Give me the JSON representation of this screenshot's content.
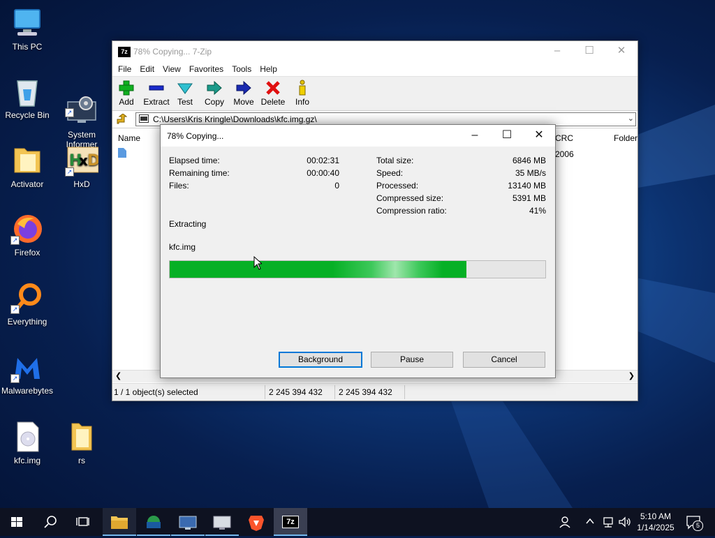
{
  "desktop": {
    "icons": [
      {
        "label": "This PC"
      },
      {
        "label": "Recycle Bin"
      },
      {
        "label": "System\nInformer"
      },
      {
        "label": "Activator"
      },
      {
        "label": "HxD"
      },
      {
        "label": "Firefox"
      },
      {
        "label": "Everything"
      },
      {
        "label": "Malwarebytes"
      },
      {
        "label": "kfc.img"
      },
      {
        "label": "rs"
      }
    ]
  },
  "main_window": {
    "title": "78% Copying... 7-Zip",
    "app_icon_text": "7z",
    "menu": [
      "File",
      "Edit",
      "View",
      "Favorites",
      "Tools",
      "Help"
    ],
    "toolbar": [
      {
        "label": "Add",
        "icon": "add-icon"
      },
      {
        "label": "Extract",
        "icon": "extract-icon"
      },
      {
        "label": "Test",
        "icon": "test-icon"
      },
      {
        "label": "Copy",
        "icon": "copy-icon"
      },
      {
        "label": "Move",
        "icon": "move-icon"
      },
      {
        "label": "Delete",
        "icon": "delete-icon"
      },
      {
        "label": "Info",
        "icon": "info-icon"
      }
    ],
    "path": "C:\\Users\\Kris Kringle\\Downloads\\kfc.img.gz\\",
    "columns": {
      "name": "Name",
      "crc": "CRC",
      "folder": "Folder"
    },
    "row_crc_partial": "2006",
    "status": {
      "selected": "1 / 1 object(s) selected",
      "size1": "2 245 394 432",
      "size2": "2 245 394 432"
    }
  },
  "dialog": {
    "title": "78% Copying...",
    "elapsed_label": "Elapsed time:",
    "elapsed_value": "00:02:31",
    "remaining_label": "Remaining time:",
    "remaining_value": "00:00:40",
    "files_label": "Files:",
    "files_value": "0",
    "total_label": "Total size:",
    "total_value": "6846 MB",
    "speed_label": "Speed:",
    "speed_value": "35 MB/s",
    "processed_label": "Processed:",
    "processed_value": "13140 MB",
    "compressed_label": "Compressed size:",
    "compressed_value": "5391 MB",
    "ratio_label": "Compression ratio:",
    "ratio_value": "41%",
    "operation": "Extracting",
    "current_file": "kfc.img",
    "progress_fraction": 0.79,
    "buttons": {
      "background": "Background",
      "pause": "Pause",
      "cancel": "Cancel"
    }
  },
  "taskbar": {
    "apps": [
      "file-explorer",
      "system-informer",
      "network-tool",
      "monitor-tool",
      "brave-browser",
      "7zip"
    ],
    "active_app_label": "7z",
    "clock_time": "5:10 AM",
    "clock_date": "1/14/2025",
    "notification_count": "5"
  },
  "colors": {
    "progress_green": "#06b025",
    "accent": "#0078d7",
    "taskbar": "#0e1221"
  }
}
